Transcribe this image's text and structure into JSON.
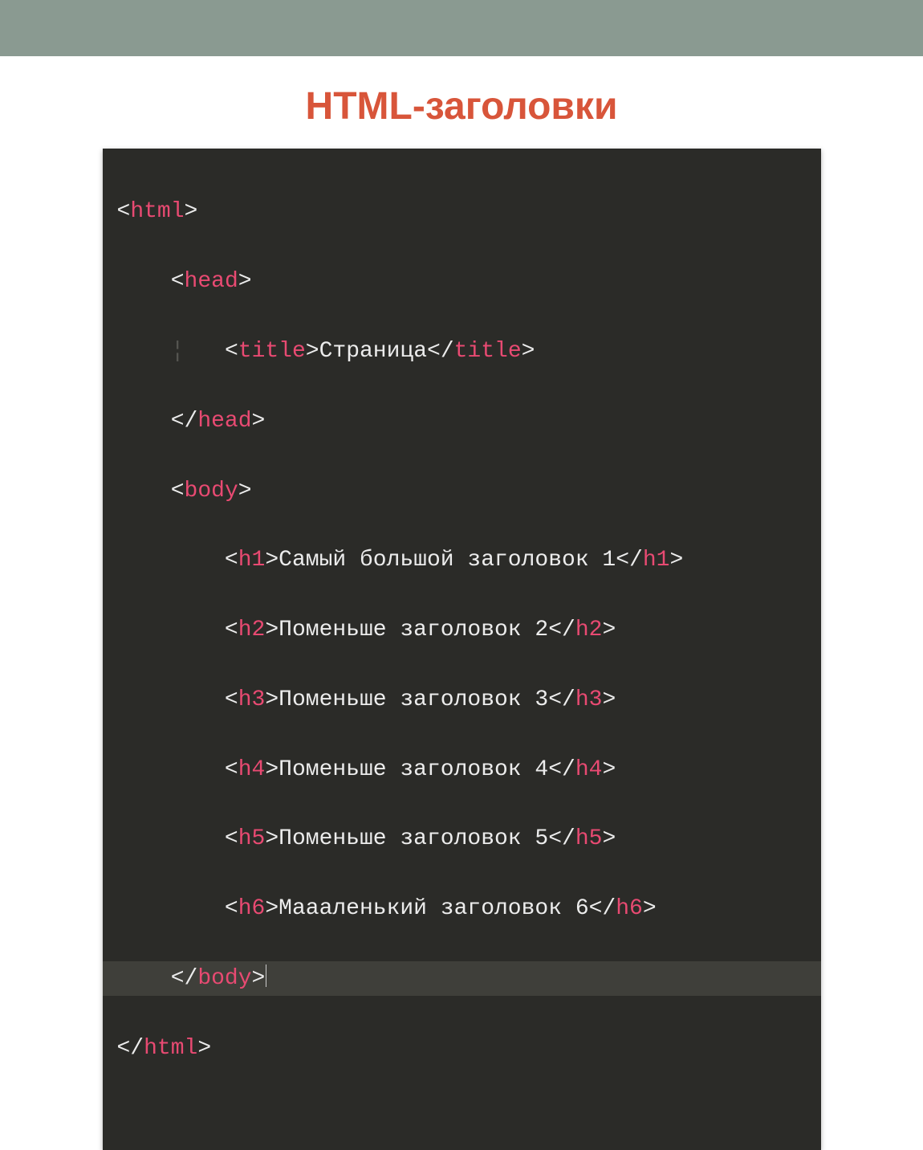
{
  "slide": {
    "title": "HTML-заголовки"
  },
  "colors": {
    "tag": "#e84a72",
    "bracket": "#ececec",
    "text": "#ececec",
    "bg": "#2b2b28",
    "topbar": "#8a9a91",
    "heading": "#d8553a"
  },
  "code": {
    "l1_tag": "html",
    "l2_tag": "head",
    "l3_tag": "title",
    "l3_text": "Страница",
    "l4_tag": "head",
    "l5_tag": "body",
    "l6_tag": "h1",
    "l6_text": "Самый большой заголовок 1",
    "l7_tag": "h2",
    "l7_text": "Поменьше заголовок 2",
    "l8_tag": "h3",
    "l8_text": "Поменьше заголовок 3",
    "l9_tag": "h4",
    "l9_text": "Поменьше заголовок 4",
    "l10_tag": "h5",
    "l10_text": "Поменьше заголовок 5",
    "l11_tag": "h6",
    "l11_text": "Маааленький заголовок 6",
    "l12_tag": "body",
    "l13_tag": "html"
  }
}
